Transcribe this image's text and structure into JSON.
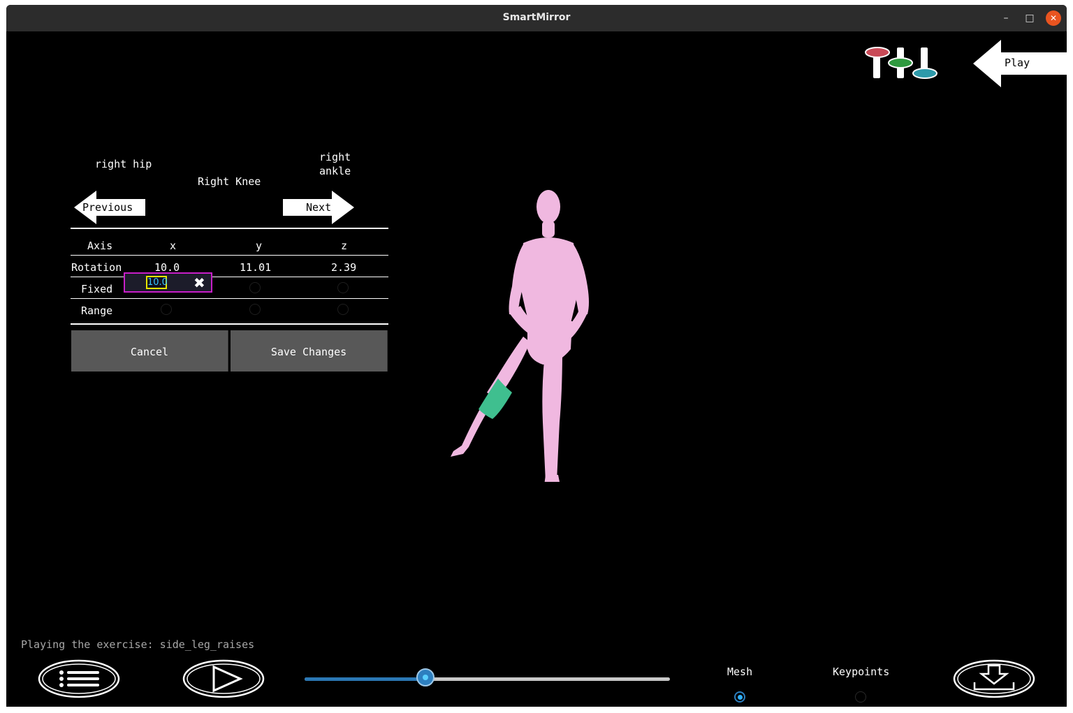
{
  "window": {
    "title": "SmartMirror",
    "minimize": "–",
    "maximize": "□",
    "close": "✕"
  },
  "top_controls": {
    "settings_icon": "sliders-icon",
    "play_label": "Play"
  },
  "joint_nav": {
    "previous_joint": "right hip",
    "current_joint": "Right Knee",
    "next_joint_line1": "right",
    "next_joint_line2": "ankle",
    "previous_label": "Previous",
    "next_label": "Next"
  },
  "table": {
    "headers": [
      "Axis",
      "x",
      "y",
      "z"
    ],
    "rotation_label": "Rotation",
    "rotation_values": [
      "10.0",
      "11.01",
      "2.39"
    ],
    "fixed_label": "Fixed",
    "fixed_x_value": "10.0",
    "range_label": "Range"
  },
  "buttons": {
    "cancel": "Cancel",
    "save": "Save Changes"
  },
  "status_text": "Playing the exercise: side_leg_raises",
  "playback": {
    "progress": 0.33
  },
  "view_mode": {
    "mesh_label": "Mesh",
    "keypoints_label": "Keypoints",
    "selected": "Mesh"
  },
  "colors": {
    "body": "#f0b8e0",
    "highlight": "#3fbf8f",
    "accent": "#2d7fbf"
  }
}
